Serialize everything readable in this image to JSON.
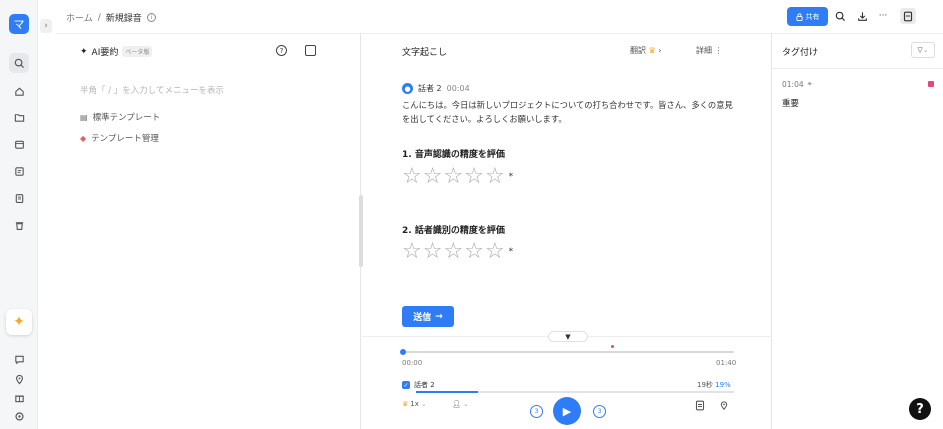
{
  "header": {
    "breadcrumb_home": "ホーム",
    "breadcrumb_sep": "/",
    "breadcrumb_current": "新規録音",
    "share_label": "共有",
    "more_label": "···"
  },
  "sidebar": {
    "logo": "マ"
  },
  "ai_summary": {
    "title": "AI要約",
    "beta": "ベータ版",
    "hint": "半角「 / 」を入力してメニューを表示",
    "items": [
      {
        "label": "標準テンプレート"
      },
      {
        "label": "テンプレート管理"
      }
    ]
  },
  "transcript": {
    "title": "文字起こし",
    "translate_label": "翻訳",
    "detail_label": "詳細",
    "speaker": "話者 2",
    "time": "00:04",
    "text": "こんにちは。今日は新しいプロジェクトについての打ち合わせです。皆さん、多くの意見を出してください。よろしくお願いします。",
    "q1": "1. 音声認識の精度を評価",
    "q2": "2. 話者識別の精度を評価",
    "required_mark": "*",
    "submit_label": "送信"
  },
  "player": {
    "current_time": "00:00",
    "total_time": "01:40",
    "speaker_label": "話者 2",
    "speaker_seconds": "19秒",
    "speaker_percent": "19%",
    "speed": "1x",
    "skip_back": "3",
    "skip_fwd": "3"
  },
  "tags": {
    "title": "タグ付け",
    "entry_time": "01:04",
    "entry_name": "重要"
  },
  "colors": {
    "accent": "#2f7df6",
    "tag_marker": "#e8467c"
  }
}
